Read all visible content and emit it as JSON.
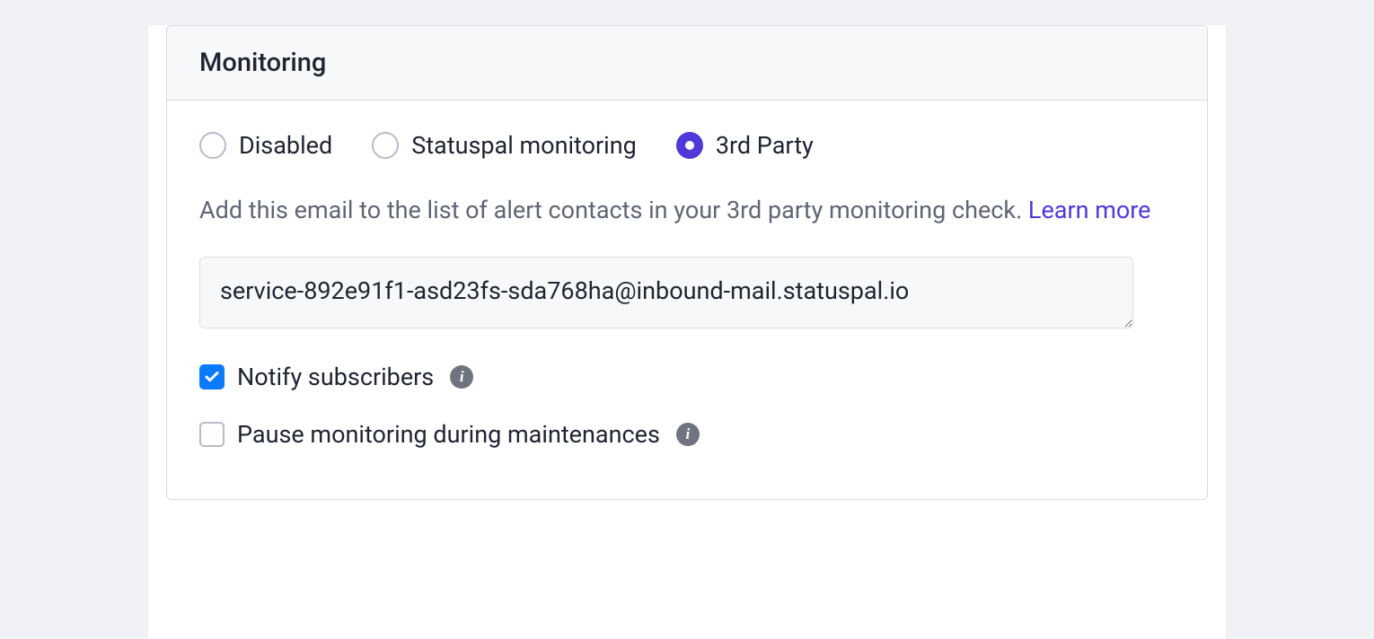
{
  "monitoring": {
    "header": "Monitoring",
    "options": {
      "disabled": "Disabled",
      "statuspal": "Statuspal monitoring",
      "third_party": "3rd Party"
    },
    "selected": "third_party",
    "description": "Add this email to the list of alert contacts in your 3rd party monitoring check. ",
    "learn_more": "Learn more",
    "email": "service-892e91f1-asd23fs-sda768ha@inbound-mail.statuspal.io",
    "notify": {
      "label": "Notify subscribers",
      "checked": true
    },
    "pause": {
      "label": "Pause monitoring during maintenances",
      "checked": false
    }
  }
}
